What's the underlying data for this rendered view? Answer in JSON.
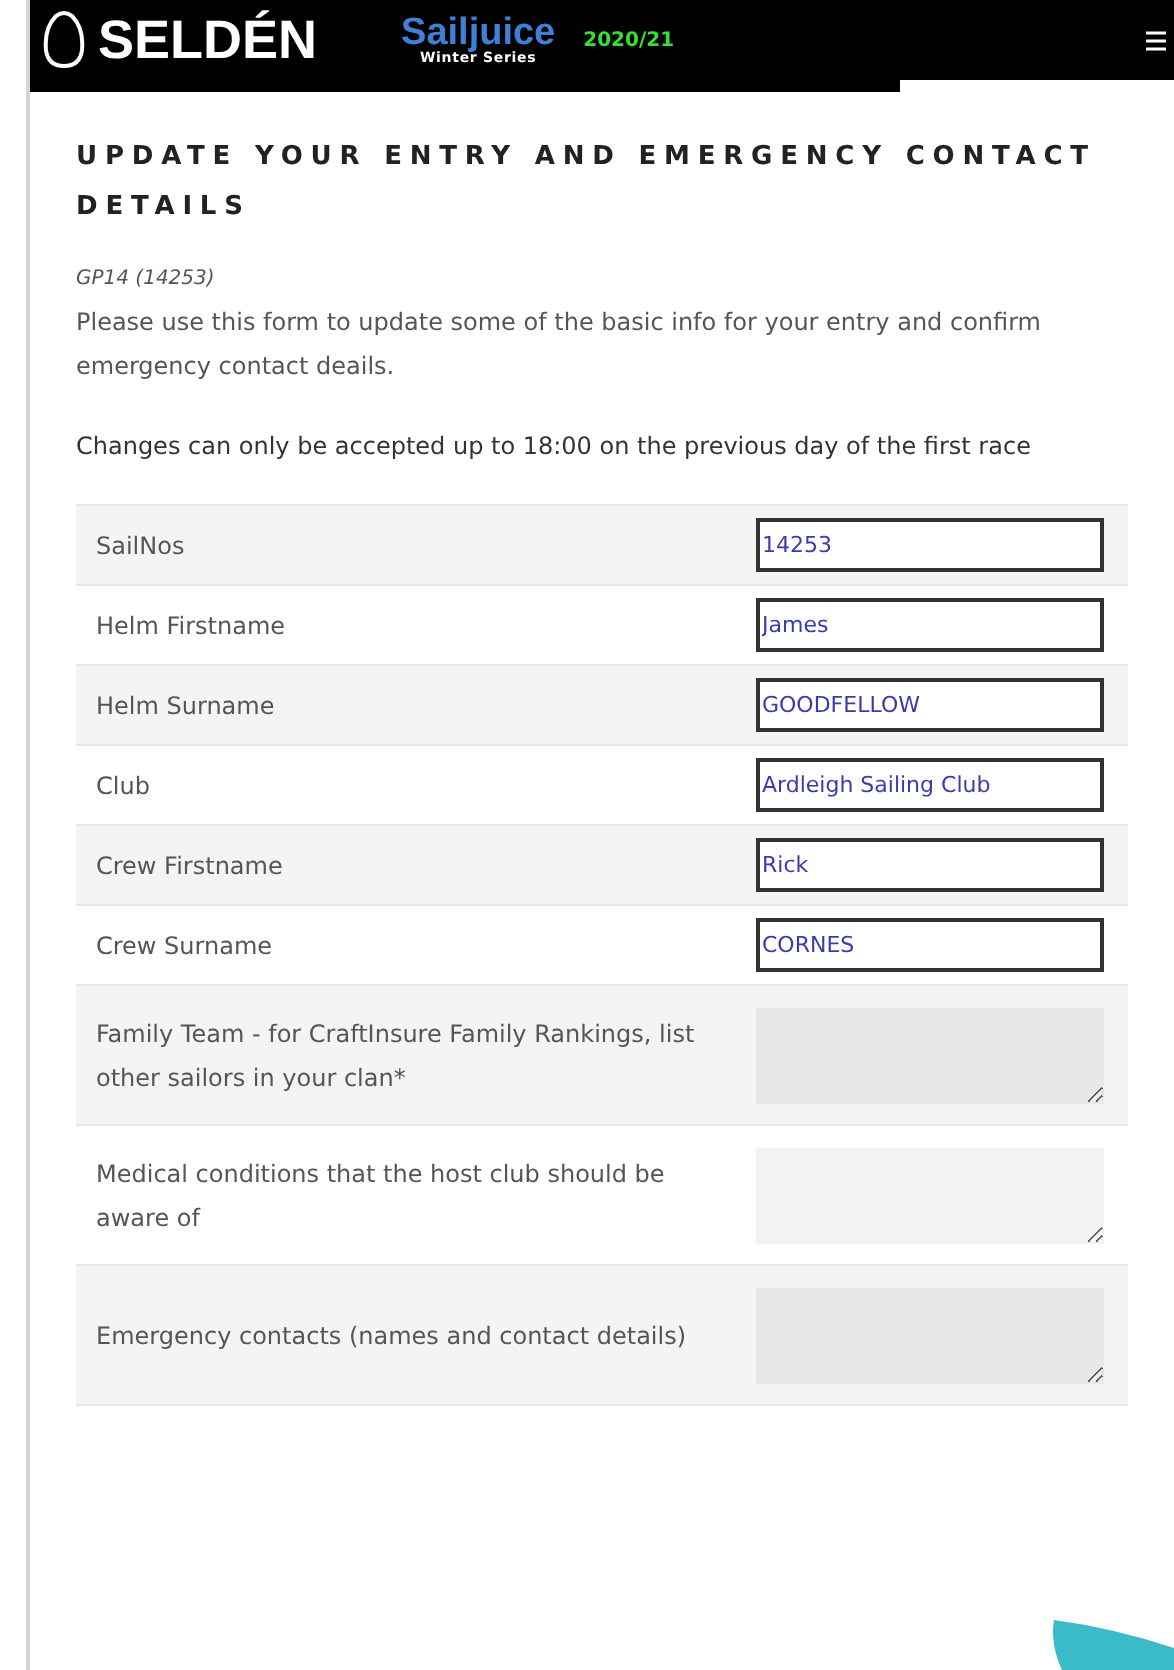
{
  "header": {
    "brand": "SELDÉN",
    "series_name": "Sailjuice",
    "series_sub": "Winter Series",
    "season": "2020/21"
  },
  "heading": "UPDATE YOUR ENTRY AND EMERGENCY CONTACT DETAILS",
  "boat": "GP14 (14253)",
  "intro": "Please use this form to update some of the basic info for your entry and confirm emergency contact deails.",
  "notice": "Changes can only be accepted up to 18:00 on the previous day of the first race",
  "fields": [
    {
      "label": "SailNos",
      "kind": "text",
      "value": "14253"
    },
    {
      "label": "Helm Firstname",
      "kind": "text",
      "value": "James"
    },
    {
      "label": "Helm Surname",
      "kind": "text",
      "value": "GOODFELLOW"
    },
    {
      "label": "Club",
      "kind": "text",
      "value": "Ardleigh Sailing Club"
    },
    {
      "label": "Crew Firstname",
      "kind": "text",
      "value": "Rick"
    },
    {
      "label": "Crew Surname",
      "kind": "text",
      "value": "CORNES"
    },
    {
      "label": "Family Team - for CraftInsure Family Rankings, list other sailors in your clan*",
      "kind": "textarea"
    },
    {
      "label": "Medical conditions that the host club should be aware of",
      "kind": "textarea"
    },
    {
      "label": "Emergency contacts (names and contact details)",
      "kind": "textarea"
    }
  ]
}
